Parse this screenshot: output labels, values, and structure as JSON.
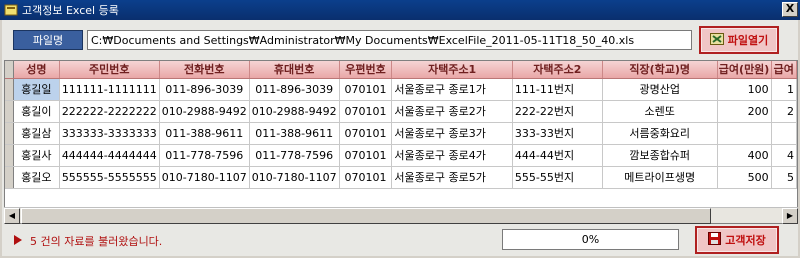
{
  "window": {
    "title": "고객정보 Excel 등록",
    "close_label": "X"
  },
  "file": {
    "label": "파일명",
    "path": "C:₩Documents and Settings₩Administrator₩My Documents₩ExcelFile_2011-05-11T18_50_40.xls",
    "open_button": "파일열기"
  },
  "grid": {
    "columns": [
      "성명",
      "주민번호",
      "전화번호",
      "휴대번호",
      "우편번호",
      "자택주소1",
      "자택주소2",
      "직장(학교)명",
      "급여(만원)",
      "급여"
    ],
    "rows": [
      [
        "홍길일",
        "111111-1111111",
        "011-896-3039",
        "011-896-3039",
        "070101",
        "서울종로구 종로1가",
        "111-11번지",
        "광명산업",
        "100",
        "1"
      ],
      [
        "홍길이",
        "222222-2222222",
        "010-2988-9492",
        "010-2988-9492",
        "070101",
        "서울종로구 종로2가",
        "222-22번지",
        "소렌또",
        "200",
        "2"
      ],
      [
        "홍길삼",
        "333333-3333333",
        "011-388-9611",
        "011-388-9611",
        "070101",
        "서울종로구 종로3가",
        "333-33번지",
        "서름중화요리",
        "",
        ""
      ],
      [
        "홍길사",
        "444444-4444444",
        "011-778-7596",
        "011-778-7596",
        "070101",
        "서울종로구 종로4가",
        "444-44번지",
        "깜보종합슈퍼",
        "400",
        "4"
      ],
      [
        "홍길오",
        "555555-5555555",
        "010-7180-1107",
        "010-7180-1107",
        "070101",
        "서울종로구 종로5가",
        "555-55번지",
        "메트라이프생명",
        "500",
        "5"
      ]
    ]
  },
  "status": {
    "message": "5 건의 자료를 불러왔습니다.",
    "progress_percent": 0,
    "progress_label": "0%",
    "save_button": "고객저장"
  },
  "colors": {
    "accent": "#b02020",
    "header_bg": "#e9a7a7",
    "titlebar": "#0b3f8c"
  },
  "icons": {
    "app": "app-icon",
    "open": "excel-file-icon",
    "save": "save-disk-icon",
    "status": "arrow-right-icon"
  }
}
